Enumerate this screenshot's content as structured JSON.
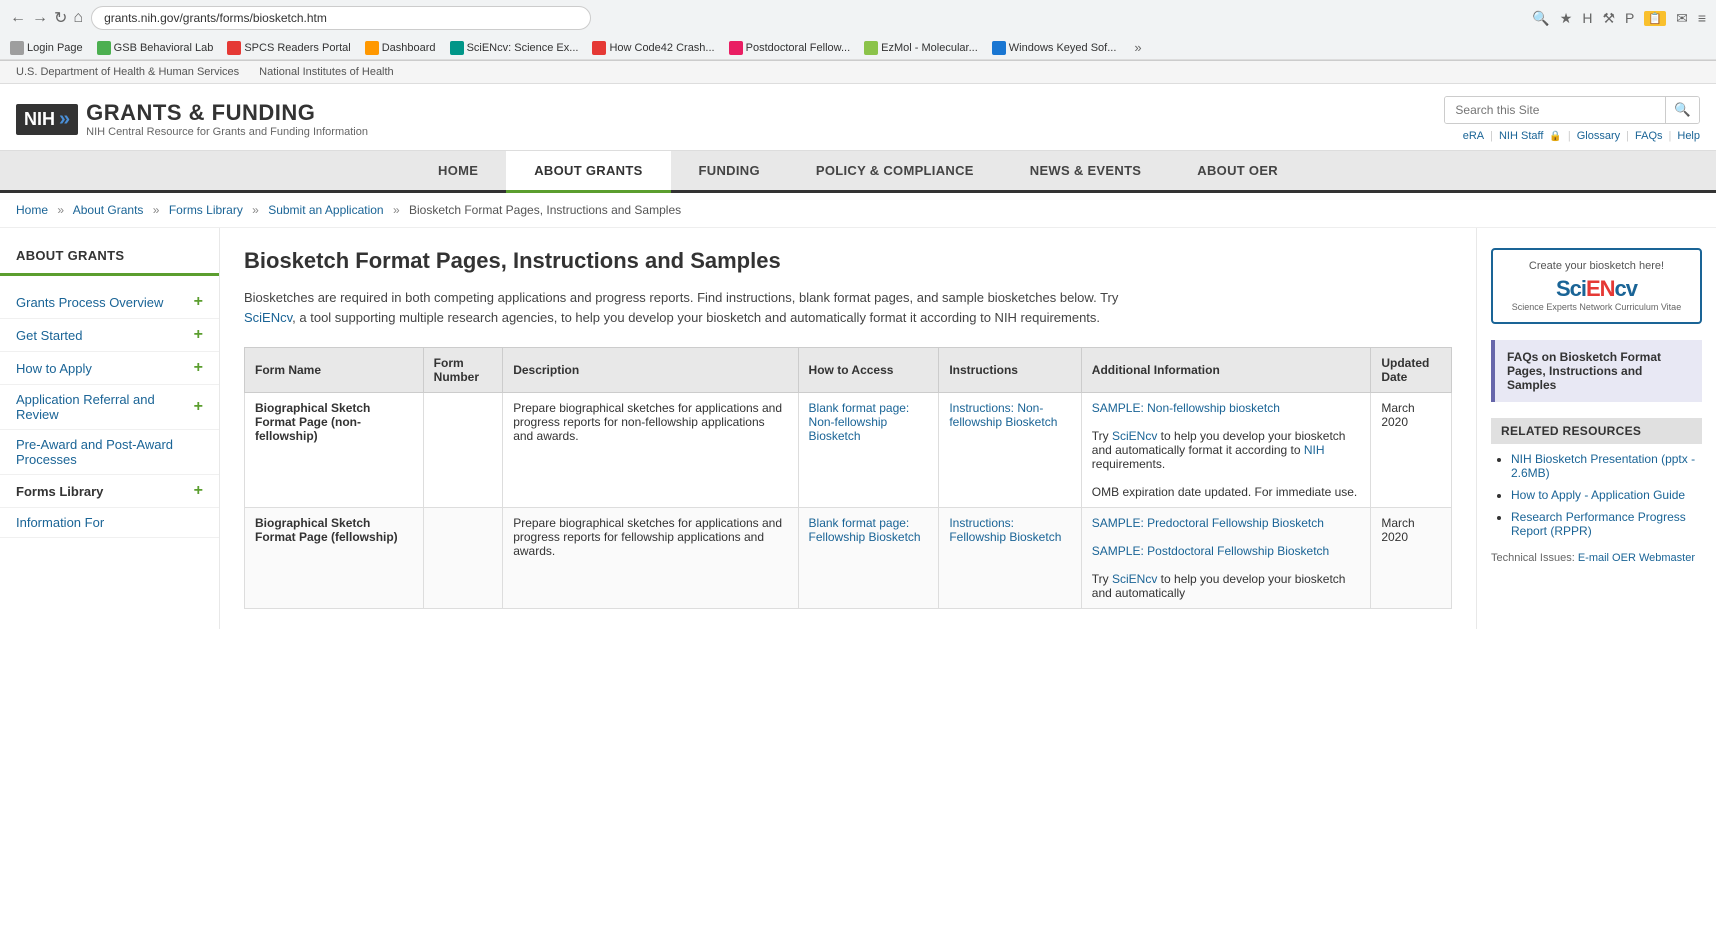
{
  "browser": {
    "url": "grants.nih.gov/grants/forms/biosketch.htm",
    "bookmarks": [
      {
        "label": "Login Page",
        "colorClass": "bk-gray"
      },
      {
        "label": "GSB Behavioral Lab",
        "colorClass": "bk-green"
      },
      {
        "label": "SPCS Readers Portal",
        "colorClass": "bk-red"
      },
      {
        "label": "Dashboard",
        "colorClass": "bk-orange"
      },
      {
        "label": "SciENcv: Science Ex...",
        "colorClass": "bk-teal"
      },
      {
        "label": "How Code42 Crash...",
        "colorClass": "bk-red"
      },
      {
        "label": "Postdoctoral Fellow...",
        "colorClass": "bk-pink"
      },
      {
        "label": "EzMol - Molecular...",
        "colorClass": "bk-lime"
      },
      {
        "label": "Windows Keyed Sof...",
        "colorClass": "bk-blue"
      }
    ]
  },
  "gov_bar": {
    "items": [
      "U.S. Department of Health & Human Services",
      "National Institutes of Health"
    ]
  },
  "header": {
    "nih_label": "NIH",
    "arrow": "»",
    "title": "GRANTS & FUNDING",
    "subtitle": "NIH Central Resource for Grants and Funding Information",
    "search_placeholder": "Search this Site",
    "links": [
      "eRA",
      "NIH Staff",
      "Glossary",
      "FAQs",
      "Help"
    ]
  },
  "nav": {
    "items": [
      "HOME",
      "ABOUT GRANTS",
      "FUNDING",
      "POLICY & COMPLIANCE",
      "NEWS & EVENTS",
      "ABOUT OER"
    ],
    "active_index": 1
  },
  "breadcrumb": {
    "items": [
      "Home",
      "About Grants",
      "Forms Library",
      "Submit an Application"
    ],
    "current": "Biosketch Format Pages, Instructions and Samples"
  },
  "sidebar": {
    "section_title": "ABOUT GRANTS",
    "items": [
      {
        "label": "Grants Process Overview",
        "has_plus": true
      },
      {
        "label": "Get Started",
        "has_plus": true
      },
      {
        "label": "How to Apply",
        "has_plus": true
      },
      {
        "label": "Application Referral and Review",
        "has_plus": true
      },
      {
        "label": "Pre-Award and Post-Award Processes",
        "has_plus": false
      },
      {
        "label": "Forms Library",
        "has_plus": true
      },
      {
        "label": "Information For",
        "has_plus": false
      }
    ]
  },
  "main": {
    "page_title": "Biosketch Format Pages, Instructions and Samples",
    "intro": "Biosketches are required in both competing applications and progress reports. Find instructions, blank format pages, and sample biosketches below. Try SciENcv, a tool supporting multiple research agencies, to help you develop your biosketch and automatically format it according to NIH requirements.",
    "table": {
      "headers": [
        "Form Name",
        "Form Number",
        "Description",
        "How to Access",
        "Instructions",
        "Additional Information",
        "Updated Date"
      ],
      "rows": [
        {
          "name": "Biographical Sketch Format Page (non-fellowship)",
          "number": "",
          "description": "Prepare biographical sketches for applications and progress reports for non-fellowship applications and awards.",
          "how_to_access": "Blank format page: Non-fellowship Biosketch",
          "instructions": "Instructions: Non-fellowship Biosketch",
          "additional": "SAMPLE: Non-fellowship biosketch\n\nTry SciENcv to help you develop your biosketch and automatically format it according to NIH requirements.\n\nOMB expiration date updated. For immediate use.",
          "updated": "March 2020"
        },
        {
          "name": "Biographical Sketch Format Page (fellowship)",
          "number": "",
          "description": "Prepare biographical sketches for applications and progress reports for fellowship applications and awards.",
          "how_to_access": "Blank format page: Fellowship Biosketch",
          "instructions": "Instructions: Fellowship Biosketch",
          "additional": "SAMPLE: Predoctoral Fellowship Biosketch\n\nSAMPLE: Postdoctoral Fellowship Biosketch\n\nTry SciENcv to help you develop your biosketch and automatically",
          "updated": "March 2020"
        }
      ]
    }
  },
  "right_sidebar": {
    "sciencv": {
      "create_text": "Create your biosketch here!",
      "logo_parts": {
        "sci": "Sci",
        "en": "EN",
        "cv": "cv"
      },
      "subtitle": "Science Experts Network Curriculum Vitae"
    },
    "faq_label": "FAQs on Biosketch Format Pages, Instructions and Samples",
    "related_title": "RELATED RESOURCES",
    "related_items": [
      {
        "label": "NIH Biosketch Presentation (pptx - 2.6MB)"
      },
      {
        "label": "How to Apply - Application Guide"
      },
      {
        "label": "Research Performance Progress Report (RPPR)"
      }
    ],
    "tech_issues": "Technical Issues:",
    "tech_link": "E-mail OER Webmaster"
  }
}
